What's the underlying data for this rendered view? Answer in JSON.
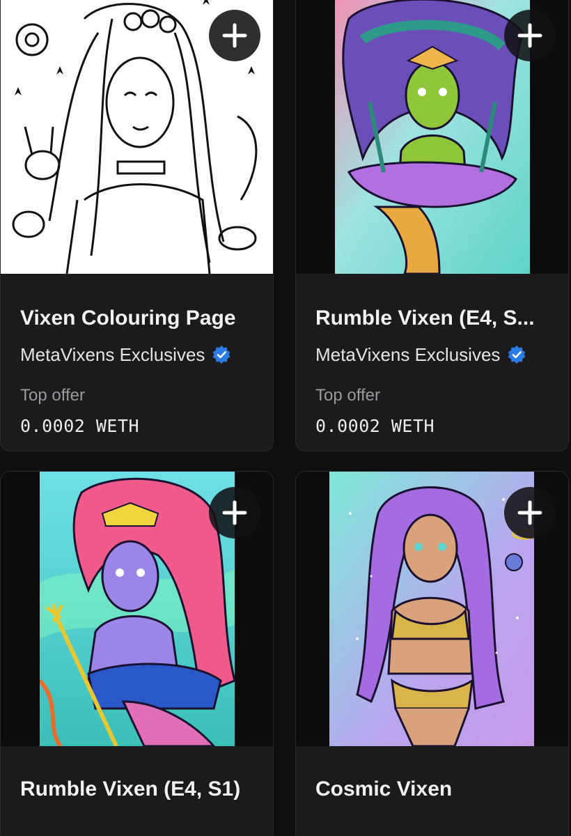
{
  "cards": [
    {
      "title": "Vixen Colouring Page",
      "collection": "MetaVixens Exclusives",
      "offer_label": "Top offer",
      "offer_value": "0.0002 WETH",
      "artwork": "line-art-vixen-colouring-page"
    },
    {
      "title": "Rumble Vixen (E4, S...",
      "collection": "MetaVixens Exclusives",
      "offer_label": "Top offer",
      "offer_value": "0.0002 WETH",
      "artwork": "green-mermaid-vixen"
    },
    {
      "title": "Rumble Vixen (E4, S1)",
      "artwork": "purple-mermaid-vixen-trident"
    },
    {
      "title": "Cosmic Vixen",
      "artwork": "purple-haired-cosmic-vixen"
    }
  ],
  "icons": {
    "add": "plus-icon",
    "verified": "verified-badge-icon"
  },
  "colors": {
    "background": "#0f0f10",
    "card": "#1b1b1d",
    "verified_blue": "#2b7be5",
    "muted_text": "#9a9a9e"
  }
}
